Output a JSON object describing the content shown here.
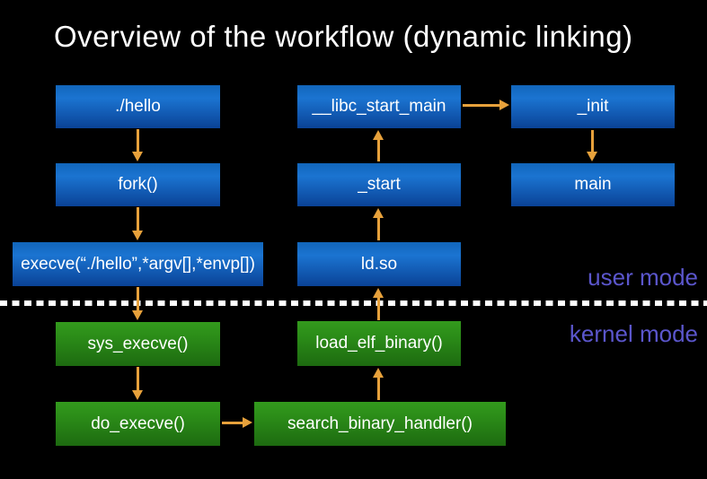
{
  "title": "Overview of the workflow (dynamic linking)",
  "mode_labels": {
    "user": "user mode",
    "kernel": "kernel mode"
  },
  "nodes": [
    {
      "id": "hello",
      "label": "./hello",
      "mode": "user"
    },
    {
      "id": "fork",
      "label": "fork()",
      "mode": "user"
    },
    {
      "id": "execve",
      "label": "execve(“./hello”,*argv[],*envp[])",
      "mode": "user"
    },
    {
      "id": "libc-start-main",
      "label": "__libc_start_main",
      "mode": "user"
    },
    {
      "id": "start",
      "label": "_start",
      "mode": "user"
    },
    {
      "id": "ldso",
      "label": "ld.so",
      "mode": "user"
    },
    {
      "id": "init",
      "label": "_init",
      "mode": "user"
    },
    {
      "id": "main",
      "label": "main",
      "mode": "user"
    },
    {
      "id": "sys-execve",
      "label": "sys_execve()",
      "mode": "kernel"
    },
    {
      "id": "load-elf-binary",
      "label": "load_elf_binary()",
      "mode": "kernel"
    },
    {
      "id": "do-execve",
      "label": "do_execve()",
      "mode": "kernel"
    },
    {
      "id": "search-binary-handler",
      "label": "search_binary_handler()",
      "mode": "kernel"
    }
  ],
  "edges": [
    {
      "from": "./hello",
      "to": "fork()"
    },
    {
      "from": "fork()",
      "to": "execve(“./hello”,*argv[],*envp[])"
    },
    {
      "from": "execve(“./hello”,*argv[],*envp[])",
      "to": "sys_execve()"
    },
    {
      "from": "sys_execve()",
      "to": "do_execve()"
    },
    {
      "from": "do_execve()",
      "to": "search_binary_handler()"
    },
    {
      "from": "search_binary_handler()",
      "to": "load_elf_binary()"
    },
    {
      "from": "load_elf_binary()",
      "to": "ld.so"
    },
    {
      "from": "ld.so",
      "to": "_start"
    },
    {
      "from": "_start",
      "to": "__libc_start_main"
    },
    {
      "from": "__libc_start_main",
      "to": "_init"
    },
    {
      "from": "_init",
      "to": "main"
    }
  ],
  "colors": {
    "background": "#000000",
    "box_blue_light": "#1b74d1",
    "box_blue_dark": "#0a4296",
    "box_green_light": "#339a1d",
    "box_green_dark": "#1d6a10",
    "arrow": "#e7a13b",
    "mode_label": "#5b56cc",
    "divider": "#ffffff",
    "text": "#ffffff"
  }
}
